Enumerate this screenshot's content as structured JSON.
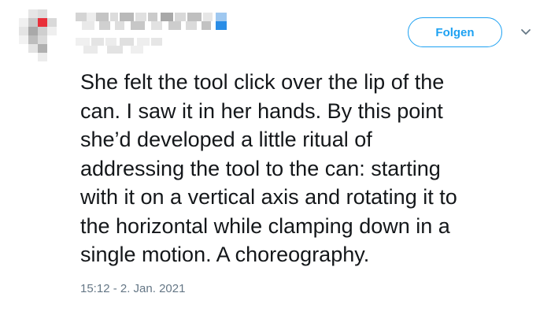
{
  "follow_button": {
    "label": "Folgen"
  },
  "tweet": {
    "text": "She felt the tool click over the lip of the\ncan. I saw it in her hands. By this point\nshe’d developed a little ritual of\naddressing the tool to the can: starting\nwith it on a vertical axis and rotating it to\nthe horizontal while clamping down in a\nsingle motion. A choreography.",
    "timestamp": "15:12 - 2. Jan. 2021"
  },
  "colors": {
    "accent": "#1da1f2",
    "text": "#14171a",
    "muted": "#657786"
  },
  "icons": {
    "more_menu": "chevron-down-icon"
  }
}
